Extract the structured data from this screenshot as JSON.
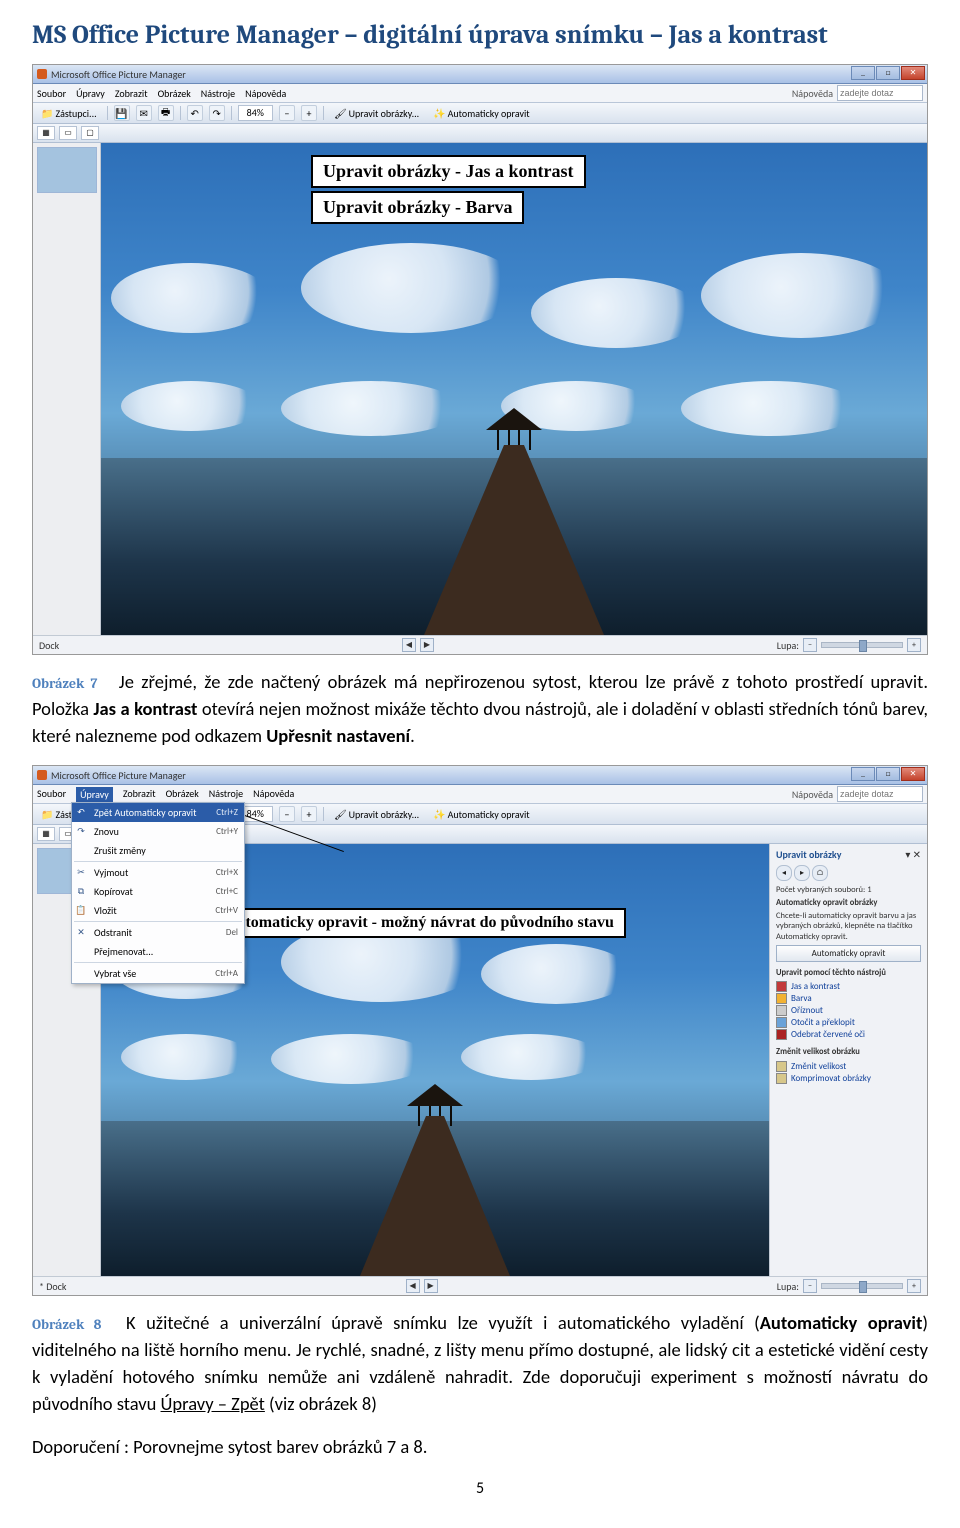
{
  "page_title": "MS Office Picture Manager – digitální úprava snímku – Jas a kontrast",
  "page_number": "5",
  "caption7_label": "Obrázek 7",
  "caption8_label": "Obrázek 8",
  "para1_a": "Je zřejmé, že zde načtený obrázek má nepřirozenou sytost, kterou lze právě z tohoto prostředí upravit. Položka ",
  "para1_b": "Jas a kontrast",
  "para1_c": " otevírá nejen  možnost mixáže těchto dvou nástrojů, ale i doladění v oblasti středních tónů barev, které nalezneme pod odkazem ",
  "para1_d": "Upřesnit nastavení",
  "para1_e": ".",
  "para2_a": "K užitečné a univerzální úpravě snímku lze využít i automatického vyladění (",
  "para2_b": "Automaticky opravit",
  "para2_c": ") viditelného na liště horního menu. Je rychlé, snadné, z lišty menu přímo dostupné, ale lidský cit a estetické vidění cesty k vyladění hotového snímku nemůže ani vzdáleně nahradit. Zde doporučuji experiment s možností návratu do původního stavu ",
  "para2_d": "Úpravy – Zpět",
  "para2_e": " (viz obrázek 8)",
  "recommend_label": "Doporučení :",
  "recommend_text": "  Porovnejme sytost barev obrázků 7 a 8.",
  "app": {
    "title": "Microsoft Office Picture Manager",
    "menu": [
      "Soubor",
      "Úpravy",
      "Zobrazit",
      "Obrázek",
      "Nástroje",
      "Nápověda"
    ],
    "help_label": "Nápověda",
    "help_placeholder": "zadejte dotaz",
    "tb_shortcuts": "Zástupci...",
    "tb_zoom": "84%",
    "tb_edit": "Upravit obrázky...",
    "tb_auto": "Automaticky opravit",
    "status_left": "Dock",
    "status_right": "Lupa:",
    "thumb_label": ""
  },
  "overlay1a": "Upravit obrázky - Jas a kontrast",
  "overlay1b": "Upravit obrázky - Barva",
  "overlay2": "Automaticky opravit - možný návrat do původního stavu",
  "edit_menu": {
    "items": [
      {
        "icon": "↶",
        "label": "Zpět Automaticky opravit",
        "shortcut": "Ctrl+Z",
        "selected": true
      },
      {
        "icon": "↷",
        "label": "Znovu",
        "shortcut": "Ctrl+Y"
      },
      {
        "icon": "",
        "label": "Zrušit změny",
        "shortcut": ""
      },
      {
        "sep": true
      },
      {
        "icon": "✂",
        "label": "Vyjmout",
        "shortcut": "Ctrl+X"
      },
      {
        "icon": "⧉",
        "label": "Kopírovat",
        "shortcut": "Ctrl+C"
      },
      {
        "icon": "📋",
        "label": "Vložit",
        "shortcut": "Ctrl+V"
      },
      {
        "sep": true
      },
      {
        "icon": "✕",
        "label": "Odstranit",
        "shortcut": "Del"
      },
      {
        "icon": "",
        "label": "Přejmenovat...",
        "shortcut": ""
      },
      {
        "sep": true
      },
      {
        "icon": "",
        "label": "Vybrat vše",
        "shortcut": "Ctrl+A"
      }
    ]
  },
  "panel": {
    "title": "Upravit obrázky",
    "count_label": "Počet vybraných souborů: 1",
    "auto_heading": "Automaticky opravit obrázky",
    "auto_desc": "Chcete-li automaticky opravit barvu a jas vybraných obrázků, klepněte na tlačítko Automaticky opravit.",
    "auto_btn": "Automaticky opravit",
    "tools_heading": "Upravit pomocí těchto nástrojů",
    "tools": [
      {
        "label": "Jas a kontrast",
        "swatch": "#c23a3a"
      },
      {
        "label": "Barva",
        "swatch": "#f2b233"
      },
      {
        "label": "Oříznout",
        "swatch": "#cccccc"
      },
      {
        "label": "Otočit a překlopit",
        "swatch": "#6aa2d8"
      },
      {
        "label": "Odebrat červené oči",
        "swatch": "#a22"
      }
    ],
    "resize_heading": "Změnit velikost obrázku",
    "resize": [
      {
        "label": "Změnit velikost"
      },
      {
        "label": "Komprimovat obrázky"
      }
    ]
  },
  "status2_left": "* Dock"
}
